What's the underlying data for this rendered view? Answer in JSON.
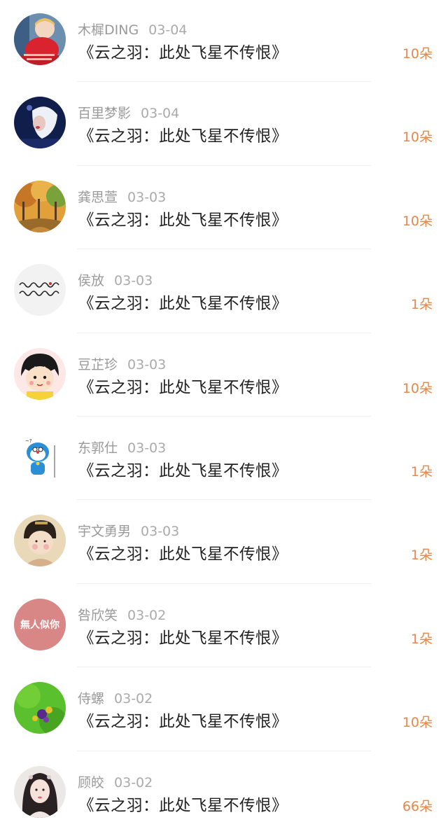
{
  "colors": {
    "accent": "#e4874a",
    "name_text": "#9a9a9a",
    "title_text": "#222222"
  },
  "items": [
    {
      "name": "木樨DING",
      "date": "03-04",
      "title": "《云之羽：此处飞星不传恨》",
      "count": "10朵",
      "avatar_icon": "baby-photo-avatar"
    },
    {
      "name": "百里梦影",
      "date": "03-04",
      "title": "《云之羽：此处飞星不传恨》",
      "count": "10朵",
      "avatar_icon": "portrait-photo-avatar"
    },
    {
      "name": "龚思萱",
      "date": "03-03",
      "title": "《云之羽：此处飞星不传恨》",
      "count": "10朵",
      "avatar_icon": "autumn-trees-avatar"
    },
    {
      "name": "侯放",
      "date": "03-03",
      "title": "《云之羽：此处飞星不传恨》",
      "count": "1朵",
      "avatar_icon": "calligraphy-text-avatar"
    },
    {
      "name": "豆芷珍",
      "date": "03-03",
      "title": "《云之羽：此处飞星不传恨》",
      "count": "10朵",
      "avatar_icon": "cartoon-girl-avatar"
    },
    {
      "name": "东郭仕",
      "date": "03-03",
      "title": "《云之羽：此处飞星不传恨》",
      "count": "1朵",
      "avatar_icon": "doraemon-avatar"
    },
    {
      "name": "宇文勇男",
      "date": "03-03",
      "title": "《云之羽：此处飞星不传恨》",
      "count": "1朵",
      "avatar_icon": "tang-lady-avatar"
    },
    {
      "name": "咎欣笑",
      "date": "03-02",
      "title": "《云之羽：此处飞星不传恨》",
      "count": "1朵",
      "avatar_icon": "text-badge-avatar",
      "avatar_text": "無人似你"
    },
    {
      "name": "侍螺",
      "date": "03-02",
      "title": "《云之羽：此处飞星不传恨》",
      "count": "10朵",
      "avatar_icon": "green-flowers-avatar"
    },
    {
      "name": "顾皎",
      "date": "03-02",
      "title": "《云之羽：此处飞星不传恨》",
      "count": "66朵",
      "avatar_icon": "ancient-beauty-avatar"
    }
  ]
}
